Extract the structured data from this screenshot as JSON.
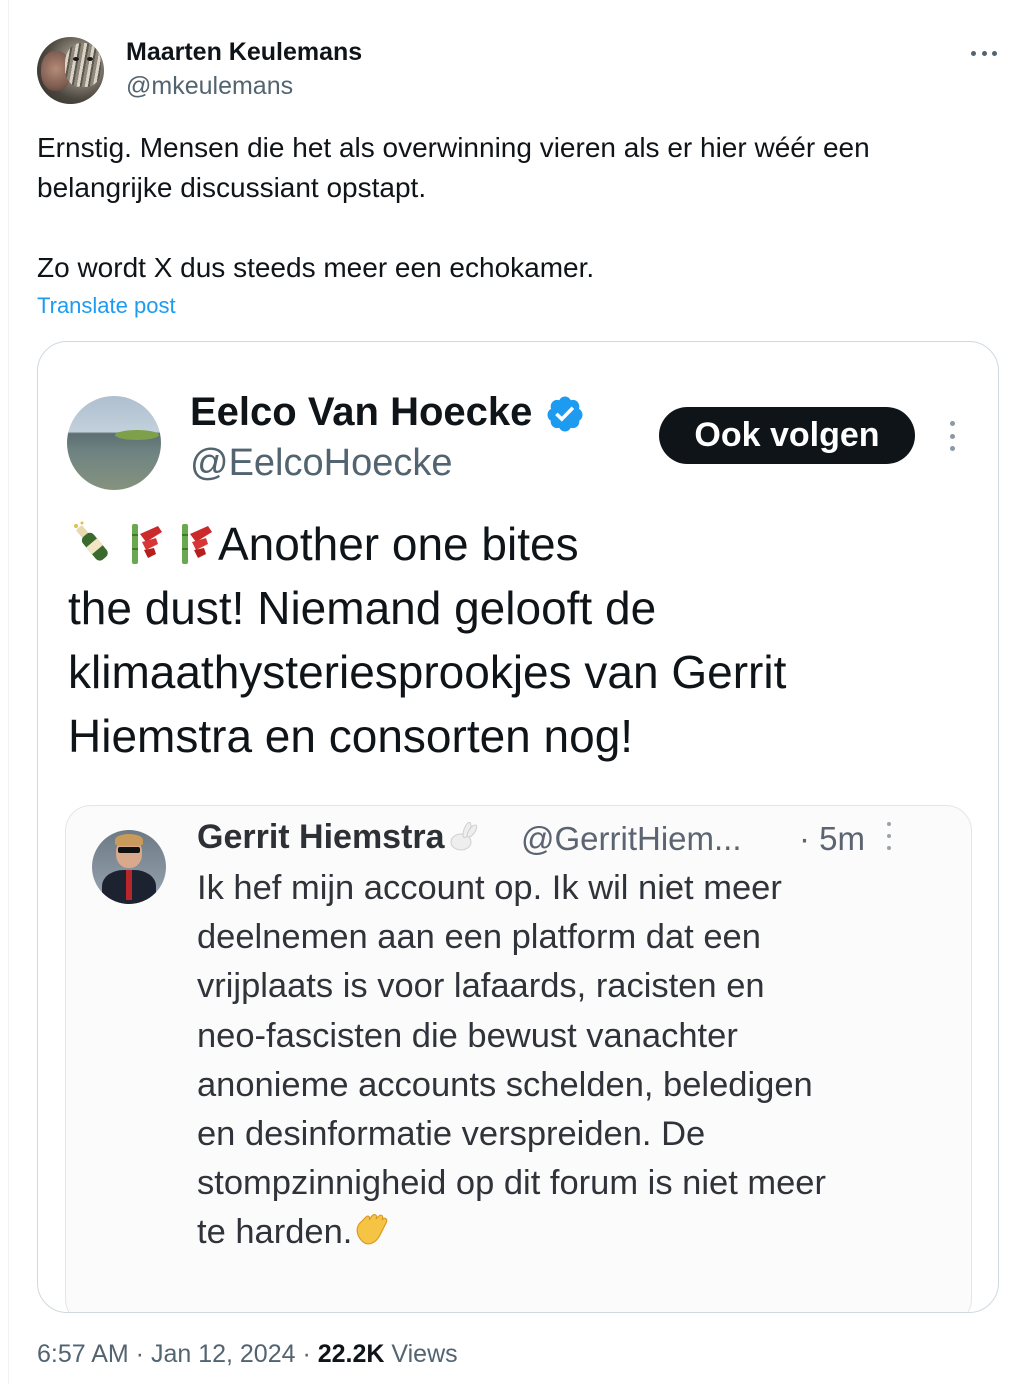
{
  "post": {
    "author": {
      "name": "Maarten Keulemans",
      "handle": "@mkeulemans"
    },
    "text_lines": [
      "Ernstig. Mensen die het als overwinning vieren als er hier wéér een",
      "belangrijke discussiant opstapt.",
      "Zo wordt X dus steeds meer een echokamer."
    ],
    "translate_label": "Translate post",
    "timestamp": "6:57 AM · Jan 12, 2024 · ",
    "views_count": "22.2K",
    "views_label": " Views"
  },
  "attached": {
    "author": {
      "name": "Eelco Van Hoecke",
      "handle": "@EelcoHoecke",
      "verified": true
    },
    "follow_label": "Ook volgen",
    "text_line1": "Another one bites",
    "text_lines": [
      "the dust! Niemand gelooft de",
      "klimaathysteriesprookjes van Gerrit",
      "Hiemstra en consorten nog!"
    ],
    "emojis": [
      "bottle-icon",
      "firecracker-icon",
      "firecracker-icon"
    ]
  },
  "embedded": {
    "author": {
      "name": "Gerrit Hiemstra",
      "handle": "@GerritHiem...",
      "time": "· 5m"
    },
    "text_lines": [
      "Ik hef mijn account op. Ik wil niet meer",
      "deelnemen aan een platform dat een",
      "vrijplaats is voor lafaards, racisten en",
      "neo-fascisten die bewust vanachter",
      "anonieme accounts schelden, beledigen",
      "en desinformatie verspreiden. De",
      "stompzinnigheid op dit forum is niet meer",
      "te harden."
    ]
  },
  "colors": {
    "accent": "#1d9bf0",
    "text": "#0f1419",
    "secondary": "#536471",
    "button": "#0f1419"
  }
}
